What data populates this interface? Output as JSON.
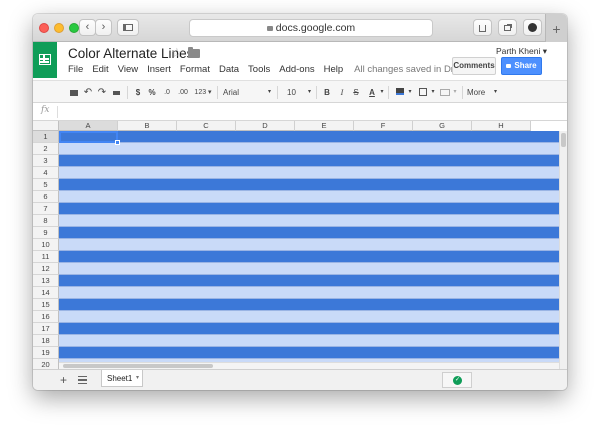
{
  "browser": {
    "url": "docs.google.com",
    "back_label": "‹",
    "forward_label": "›",
    "new_tab_label": "+"
  },
  "doc": {
    "title": "Color Alternate Lines",
    "save_status": "All changes saved in Drive",
    "user": "Parth Kheni ▾"
  },
  "menu": [
    "File",
    "Edit",
    "View",
    "Insert",
    "Format",
    "Data",
    "Tools",
    "Add-ons",
    "Help"
  ],
  "buttons": {
    "comments": "Comments",
    "share": "Share"
  },
  "toolbar": {
    "currency": "$",
    "percent": "%",
    "dec_decrease": ".0",
    "dec_increase": ".00",
    "number_format": "123 ▾",
    "font": "Arial",
    "font_size": "10",
    "bold": "B",
    "italic": "I",
    "strike": "S",
    "text_color": "A",
    "more": "More"
  },
  "formula_bar": {
    "fx": "fx",
    "value": ""
  },
  "columns": [
    "A",
    "B",
    "C",
    "D",
    "E",
    "F",
    "G",
    "H"
  ],
  "rows": [
    "1",
    "2",
    "3",
    "4",
    "5",
    "6",
    "7",
    "8",
    "9",
    "10",
    "11",
    "12",
    "13",
    "14",
    "15",
    "16",
    "17",
    "18",
    "19",
    "20"
  ],
  "band_colors": {
    "dark": "#3c78d8",
    "light": "#c9daf8"
  },
  "sheets": [
    "Sheet1"
  ],
  "colors": {
    "brand_green": "#0f9d58",
    "share_blue": "#4d90fe"
  }
}
